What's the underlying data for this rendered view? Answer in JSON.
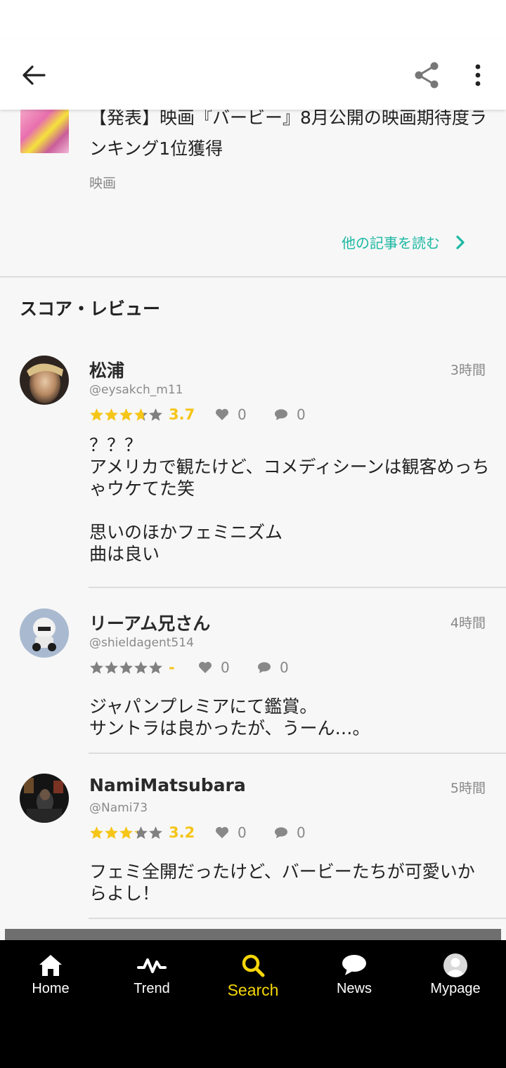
{
  "header": {
    "back_icon": "arrow-left-icon",
    "share_icon": "share-icon",
    "more_icon": "more-vertical-icon"
  },
  "article": {
    "title": "【発表】映画『バービー』8月公開の映画期待度ランキング1位獲得",
    "category": "映画",
    "read_more": "他の記事を読む"
  },
  "section_title": "スコア・レビュー",
  "reviews": [
    {
      "name": "松浦",
      "handle": "@eysakch_m11",
      "time": "3時間",
      "rating": 3.7,
      "score_text": "3.7",
      "likes": "0",
      "comments": "0",
      "text": "？？？\nアメリカで観たけど、コメディシーンは観客めっちゃウケてた笑\n\n思いのほかフェミニズム\n曲は良い"
    },
    {
      "name": "リーアム兄さん",
      "handle": "@shieldagent514",
      "time": "4時間",
      "rating": 0,
      "score_text": "-",
      "likes": "0",
      "comments": "0",
      "text": "ジャパンプレミアにて鑑賞。\nサントラは良かったが、うーん…。"
    },
    {
      "name": "NamiMatsubara",
      "handle": "@Nami73",
      "time": "5時間",
      "rating": 3.2,
      "score_text": "3.2",
      "likes": "0",
      "comments": "0",
      "text": "フェミ全開だったけど、バービーたちが可愛いからよし！"
    }
  ],
  "nav": {
    "items": [
      {
        "label": "Home",
        "icon": "home-icon",
        "active": false
      },
      {
        "label": "Trend",
        "icon": "trend-icon",
        "active": false
      },
      {
        "label": "Search",
        "icon": "search-icon",
        "active": true
      },
      {
        "label": "News",
        "icon": "news-icon",
        "active": false
      },
      {
        "label": "Mypage",
        "icon": "user-icon",
        "active": false
      }
    ]
  },
  "colors": {
    "accent": "#1bb8a2",
    "star": "#f5c518",
    "star_empty": "#808080",
    "nav_active": "#f5d60a",
    "nav_bg": "#000000"
  }
}
